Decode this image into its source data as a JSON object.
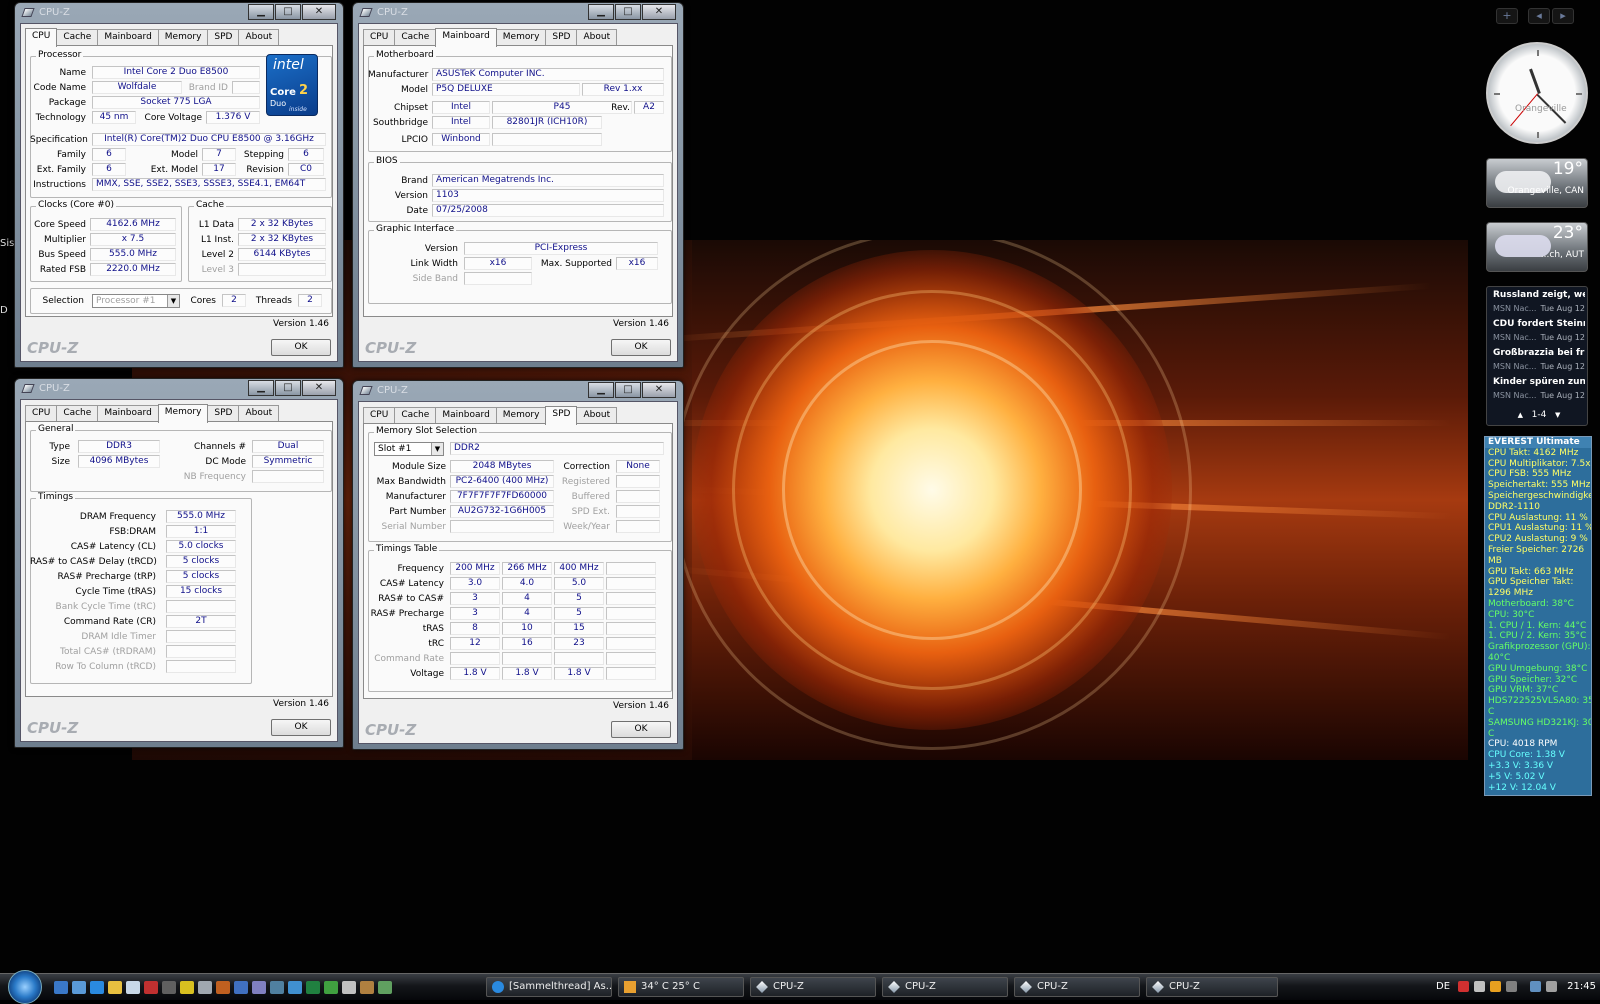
{
  "app_title": "CPU-Z",
  "tabs": [
    "CPU",
    "Cache",
    "Mainboard",
    "Memory",
    "SPD",
    "About"
  ],
  "version": "Version 1.46",
  "brand": "CPU-Z",
  "ok_label": "OK",
  "window_controls": {
    "min": "▁",
    "max": "□",
    "close": "✕"
  },
  "cpu_tab": {
    "processor_group": "Processor",
    "labels": {
      "name": "Name",
      "code_name": "Code Name",
      "brand_id": "Brand ID",
      "package": "Package",
      "technology": "Technology",
      "core_voltage": "Core Voltage",
      "specification": "Specification",
      "family": "Family",
      "model": "Model",
      "stepping": "Stepping",
      "ext_family": "Ext. Family",
      "ext_model": "Ext. Model",
      "revision": "Revision",
      "instructions": "Instructions"
    },
    "values": {
      "name": "Intel Core 2 Duo E8500",
      "code_name": "Wolfdale",
      "package": "Socket 775 LGA",
      "technology": "45 nm",
      "core_voltage": "1.376 V",
      "specification": "Intel(R) Core(TM)2 Duo CPU     E8500  @ 3.16GHz",
      "family": "6",
      "model": "7",
      "stepping": "6",
      "ext_family": "6",
      "ext_model": "17",
      "revision": "C0",
      "instructions": "MMX, SSE, SSE2, SSE3, SSSE3, SSE4.1, EM64T"
    },
    "logo": {
      "line1": "intel",
      "line2": "Core",
      "line3": "2",
      "line4": "Duo",
      "line5": "inside"
    },
    "clocks_group": "Clocks (Core #0)",
    "clocks_labels": {
      "core_speed": "Core Speed",
      "multiplier": "Multiplier",
      "bus_speed": "Bus Speed",
      "rated_fsb": "Rated FSB"
    },
    "clocks": {
      "core_speed": "4162.6 MHz",
      "multiplier": "x 7.5",
      "bus_speed": "555.0 MHz",
      "rated_fsb": "2220.0 MHz"
    },
    "cache_group": "Cache",
    "cache_labels": {
      "l1_data": "L1 Data",
      "l1_inst": "L1 Inst.",
      "level2": "Level 2",
      "level3": "Level 3"
    },
    "cache": {
      "l1_data": "2 x 32 KBytes",
      "l1_inst": "2 x 32 KBytes",
      "level2": "6144 KBytes"
    },
    "selection_label": "Selection",
    "selection_value": "Processor #1",
    "cores_label": "Cores",
    "cores": "2",
    "threads_label": "Threads",
    "threads": "2"
  },
  "mainboard_tab": {
    "motherboard_group": "Motherboard",
    "labels": {
      "manufacturer": "Manufacturer",
      "model": "Model",
      "chipset": "Chipset",
      "rev": "Rev.",
      "southbridge": "Southbridge",
      "lpcio": "LPCIO"
    },
    "values": {
      "manufacturer": "ASUSTeK Computer INC.",
      "model": "P5Q DELUXE",
      "model_rev": "Rev 1.xx",
      "chipset_vendor": "Intel",
      "chipset": "P45",
      "chipset_rev": "A2",
      "south_vendor": "Intel",
      "southbridge": "82801JR (ICH10R)",
      "lpcio": "Winbond"
    },
    "bios_group": "BIOS",
    "bios_labels": {
      "brand": "Brand",
      "version": "Version",
      "date": "Date"
    },
    "bios": {
      "brand": "American Megatrends Inc.",
      "version": "1103",
      "date": "07/25/2008"
    },
    "gi_group": "Graphic Interface",
    "gi_labels": {
      "version": "Version",
      "link_width": "Link Width",
      "max_supported": "Max. Supported",
      "side_band": "Side Band"
    },
    "gi": {
      "version": "PCI-Express",
      "link_width": "x16",
      "max_supported": "x16"
    }
  },
  "memory_tab": {
    "general_group": "General",
    "labels": {
      "type": "Type",
      "channels": "Channels #",
      "size": "Size",
      "dc_mode": "DC Mode",
      "nb_freq": "NB Frequency"
    },
    "values": {
      "type": "DDR3",
      "channels": "Dual",
      "size": "4096 MBytes",
      "dc_mode": "Symmetric"
    },
    "timings_group": "Timings",
    "timing_labels": {
      "dram_freq": "DRAM Frequency",
      "fsb_dram": "FSB:DRAM",
      "cas": "CAS# Latency (CL)",
      "trcd": "RAS# to CAS# Delay (tRCD)",
      "trp": "RAS# Precharge (tRP)",
      "tras": "Cycle Time (tRAS)",
      "trc": "Bank Cycle Time (tRC)",
      "cr": "Command Rate (CR)",
      "idle": "DRAM Idle Timer",
      "trdram": "Total CAS# (tRDRAM)",
      "trcd2": "Row To Column (tRCD)"
    },
    "timings": {
      "dram_freq": "555.0 MHz",
      "fsb_dram": "1:1",
      "cas": "5.0 clocks",
      "trcd": "5 clocks",
      "trp": "5 clocks",
      "tras": "15 clocks",
      "cr": "2T"
    }
  },
  "spd_tab": {
    "slot_group": "Memory Slot Selection",
    "slot": "Slot #1",
    "slot_type": "DDR2",
    "labels": {
      "module_size": "Module Size",
      "max_bw": "Max Bandwidth",
      "manufacturer": "Manufacturer",
      "part": "Part Number",
      "serial": "Serial Number",
      "correction": "Correction",
      "registered": "Registered",
      "buffered": "Buffered",
      "spd_ext": "SPD Ext.",
      "week": "Week/Year"
    },
    "values": {
      "module_size": "2048 MBytes",
      "max_bw": "PC2-6400 (400 MHz)",
      "manufacturer": "7F7F7F7F7FD60000",
      "part": "AU2G732-1G6H005",
      "correction": "None"
    },
    "timings_group": "Timings Table",
    "row_labels": [
      "Frequency",
      "CAS# Latency",
      "RAS# to CAS#",
      "RAS# Precharge",
      "tRAS",
      "tRC",
      "Command Rate",
      "Voltage"
    ],
    "rows": [
      [
        "200 MHz",
        "266 MHz",
        "400 MHz",
        ""
      ],
      [
        "3.0",
        "4.0",
        "5.0",
        ""
      ],
      [
        "3",
        "4",
        "5",
        ""
      ],
      [
        "3",
        "4",
        "5",
        ""
      ],
      [
        "8",
        "10",
        "15",
        ""
      ],
      [
        "12",
        "16",
        "23",
        ""
      ],
      [
        "",
        "",
        "",
        ""
      ],
      [
        "1.8 V",
        "1.8 V",
        "1.8 V",
        ""
      ]
    ]
  },
  "desktop_left": [
    "Sis",
    "D"
  ],
  "gadgets": {
    "toolbar": [
      "+",
      "◂",
      "▸"
    ],
    "clock_city": "Orangeville",
    "weather1": {
      "temp": "19°",
      "city": "Orangeville, CAN"
    },
    "weather2": {
      "temp": "23°",
      "city": "...ch, AUT"
    },
    "news": [
      {
        "headline": "Russland zeigt, wer i...",
        "source": "MSN Nac...",
        "date": "Tue Aug 12"
      },
      {
        "headline": "CDU fordert Steinme...",
        "source": "MSN Nac...",
        "date": "Tue Aug 12"
      },
      {
        "headline": "Großbrazzia bei frühe...",
        "source": "MSN Nac...",
        "date": "Tue Aug 12"
      },
      {
        "headline": "Kinder spüren zuneh...",
        "source": "MSN Nac...",
        "date": "Tue Aug 12"
      }
    ],
    "news_pager": "1-4",
    "news_prev": "▲",
    "news_next": "▼",
    "everest_title": "EVEREST Ultimate",
    "everest_lines": [
      {
        "text": "CPU Takt: 4162 MHz",
        "color": "#ffff66"
      },
      {
        "text": "CPU Multiplikator: 7.5x",
        "color": "#ffff66"
      },
      {
        "text": "CPU FSB: 555 MHz",
        "color": "#ffff66"
      },
      {
        "text": "Speichertakt: 555 MHz",
        "color": "#ffff66"
      },
      {
        "text": "Speichergeschwindigkeit:",
        "color": "#ffff66"
      },
      {
        "text": "DDR2-1110",
        "color": "#ffff66"
      },
      {
        "text": "CPU Auslastung: 11 %",
        "color": "#ffff66"
      },
      {
        "text": "CPU1 Auslastung: 11 %",
        "color": "#ffff66"
      },
      {
        "text": "CPU2 Auslastung: 9 %",
        "color": "#ffff66"
      },
      {
        "text": "Freier Speicher: 2726",
        "color": "#ffff66"
      },
      {
        "text": "MB",
        "color": "#ffff66"
      },
      {
        "text": "GPU Takt: 663 MHz",
        "color": "#ffff66"
      },
      {
        "text": "GPU Speicher Takt:",
        "color": "#ffff66"
      },
      {
        "text": "1296 MHz",
        "color": "#ffff66"
      },
      {
        "text": "Motherboard: 38°C",
        "color": "#66ff66"
      },
      {
        "text": "CPU: 30°C",
        "color": "#66ff66"
      },
      {
        "text": "1. CPU / 1. Kern: 44°C",
        "color": "#66ff66"
      },
      {
        "text": "1. CPU / 2. Kern: 35°C",
        "color": "#66ff66"
      },
      {
        "text": "Grafikprozessor (GPU):",
        "color": "#66ff66"
      },
      {
        "text": "40°C",
        "color": "#66ff66"
      },
      {
        "text": "GPU Umgebung: 38°C",
        "color": "#66ff66"
      },
      {
        "text": "GPU Speicher: 32°C",
        "color": "#66ff66"
      },
      {
        "text": "GPU VRM: 37°C",
        "color": "#66ff66"
      },
      {
        "text": "HDS722525VLSA80: 35°",
        "color": "#66ff66"
      },
      {
        "text": "C",
        "color": "#66ff66"
      },
      {
        "text": "SAMSUNG HD321KJ: 30°",
        "color": "#66ff66"
      },
      {
        "text": "C",
        "color": "#66ff66"
      },
      {
        "text": "CPU: 4018 RPM",
        "color": "#ffffff"
      },
      {
        "text": "CPU Core: 1.38 V",
        "color": "#66ffff"
      },
      {
        "text": "+3.3 V: 3.36 V",
        "color": "#66ffff"
      },
      {
        "text": "+5 V: 5.02 V",
        "color": "#66ffff"
      },
      {
        "text": "+12 V: 12.04 V",
        "color": "#66ffff"
      }
    ]
  },
  "taskbar": {
    "buttons": [
      "[Sammelthread] As...",
      "34° C 25° C",
      "CPU-Z",
      "CPU-Z",
      "CPU-Z",
      "CPU-Z"
    ],
    "lang": "DE",
    "time": "21:45"
  }
}
